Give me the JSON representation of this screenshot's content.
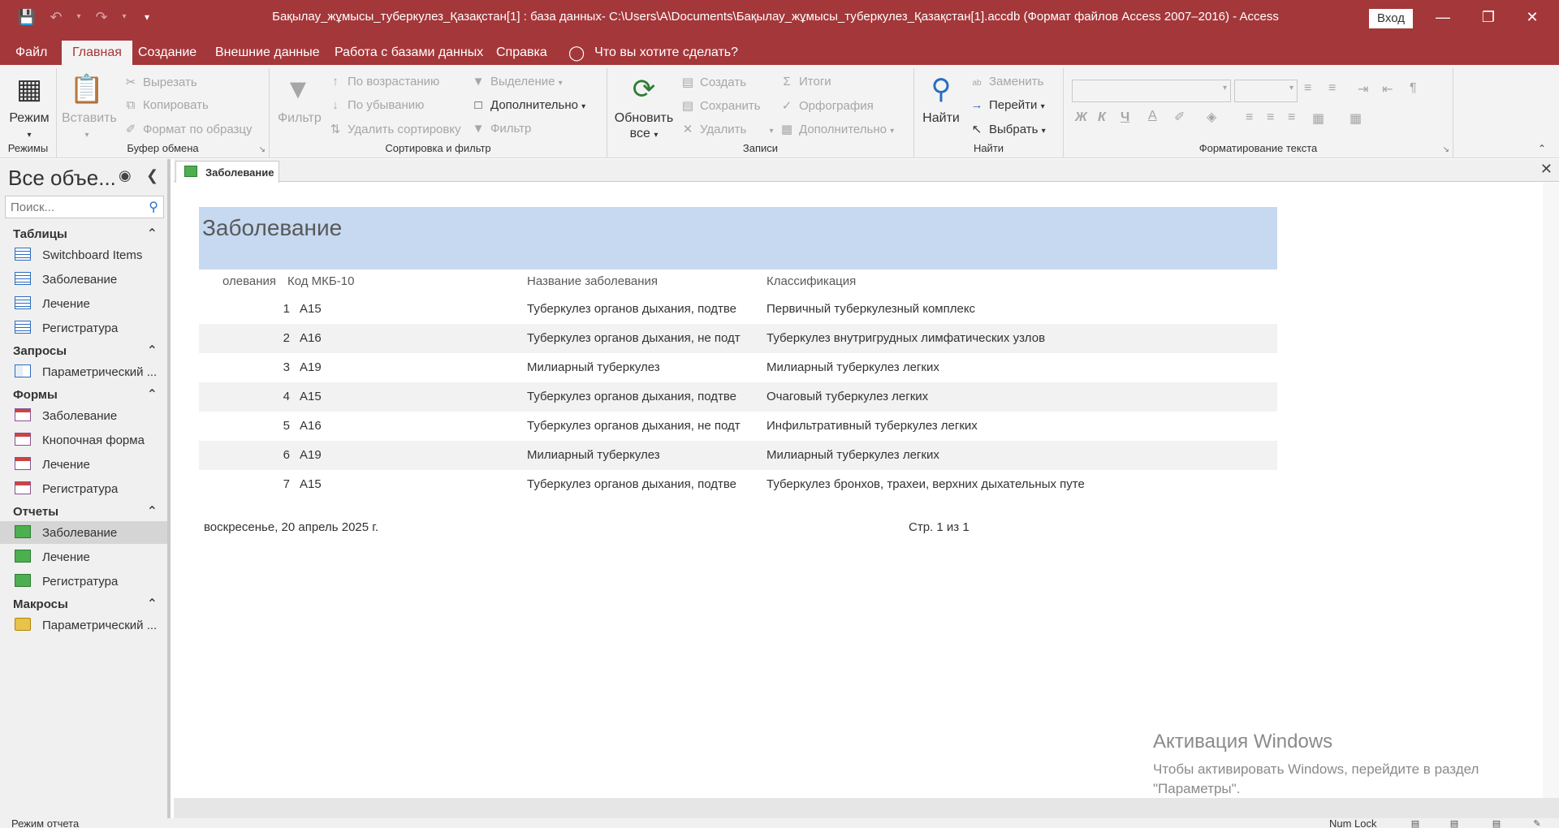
{
  "window": {
    "title": "Бақылау_жұмысы_туберкулез_Қазақстан[1] : база данных- C:\\Users\\A\\Documents\\Бақылау_жұмысы_туберкулез_Қазақстан[1].accdb (Формат файлов Access 2007–2016)  -  Access",
    "sign_in": "Вход"
  },
  "menu": {
    "tabs": [
      "Файл",
      "Главная",
      "Создание",
      "Внешние данные",
      "Работа с базами данных",
      "Справка"
    ],
    "active_tab": "Главная",
    "tell_me": "Что вы хотите сделать?"
  },
  "ribbon": {
    "groups": {
      "views": "Режимы",
      "clipboard": "Буфер обмена",
      "sort_filter": "Сортировка и фильтр",
      "records": "Записи",
      "find": "Найти",
      "text_format": "Форматирование текста"
    },
    "view_button": "Режим",
    "paste": "Вставить",
    "cut": "Вырезать",
    "copy": "Копировать",
    "format_painter": "Формат по образцу",
    "filter": "Фильтр",
    "ascending": "По возрастанию",
    "descending": "По убыванию",
    "remove_sort": "Удалить сортировку",
    "selection": "Выделение",
    "advanced": "Дополнительно",
    "toggle_filter": "Фильтр",
    "refresh": "Обновить все",
    "new": "Создать",
    "save": "Сохранить",
    "delete": "Удалить",
    "totals": "Итоги",
    "spelling": "Орфография",
    "more": "Дополнительно",
    "find": "Найти",
    "replace": "Заменить",
    "goto": "Перейти",
    "select": "Выбрать",
    "bold": "Ж",
    "italic": "К",
    "underline": "Ч"
  },
  "nav": {
    "header": "Все объе...",
    "search_placeholder": "Поиск...",
    "sections": [
      {
        "name": "Таблицы",
        "items": [
          "Switchboard Items",
          "Заболевание",
          "Лечение",
          "Регистратура"
        ]
      },
      {
        "name": "Запросы",
        "items": [
          "Параметрический ..."
        ]
      },
      {
        "name": "Формы",
        "items": [
          "Заболевание",
          "Кнопочная форма",
          "Лечение",
          "Регистратура"
        ]
      },
      {
        "name": "Отчеты",
        "items": [
          "Заболевание",
          "Лечение",
          "Регистратура"
        ]
      },
      {
        "name": "Макросы",
        "items": [
          "Параметрический ..."
        ]
      }
    ],
    "selected_item": "Отчеты/Заболевание"
  },
  "document_tab": "Заболевание",
  "report": {
    "title": "Заболевание",
    "columns": [
      "олевания",
      "Код МКБ-10",
      "Название заболевания",
      "Классификация"
    ],
    "rows": [
      [
        "1",
        "A15",
        "Туберкулез органов дыхания, подтве",
        "Первичный туберкулезный комплекс"
      ],
      [
        "2",
        "A16",
        "Туберкулез органов дыхания, не подт",
        "Туберкулез внутригрудных лимфатических узлов"
      ],
      [
        "3",
        "A19",
        "Милиарный туберкулез",
        "Милиарный туберкулез легких"
      ],
      [
        "4",
        "A15",
        "Туберкулез органов дыхания, подтве",
        "Очаговый туберкулез легких"
      ],
      [
        "5",
        "A16",
        "Туберкулез органов дыхания, не подт",
        "Инфильтративный туберкулез легких"
      ],
      [
        "6",
        "A19",
        "Милиарный туберкулез",
        "Милиарный туберкулез легких"
      ],
      [
        "7",
        "A15",
        "Туберкулез органов дыхания, подтве",
        "Туберкулез бронхов, трахеи, верхних дыхательных путе"
      ]
    ],
    "footer_date": "воскресенье, 20 апрель 2025 г.",
    "footer_page": "Стр. 1 из 1"
  },
  "watermark": {
    "title": "Активация Windows",
    "text": "Чтобы активировать Windows, перейдите в раздел \"Параметры\"."
  },
  "status": {
    "left": "Режим отчета",
    "numlock": "Num Lock"
  },
  "colors": {
    "accent": "#a4373a",
    "report_header": "#c6d9f1",
    "alt_row": "#f2f2f2"
  }
}
